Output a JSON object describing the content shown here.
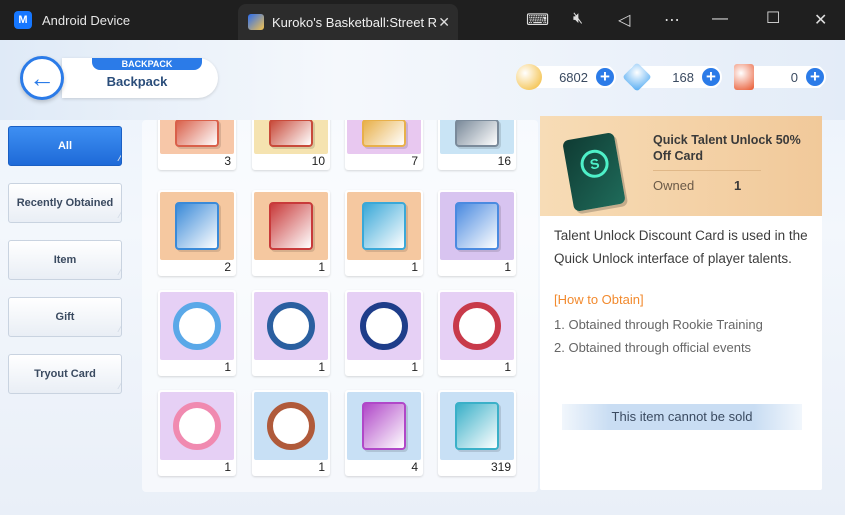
{
  "window": {
    "tab1_label": "Android Device",
    "tab2_label": "Kuroko's Basketball:Street Rivals",
    "close_tab": "✕",
    "controls": {
      "keyboard": "⌨",
      "mute": "🔇︎",
      "back": "◁",
      "more": "⋯",
      "minimize": "—",
      "maximize": "☐",
      "close": "✕"
    }
  },
  "header": {
    "back_arrow": "←",
    "badge": "BACKPACK",
    "title": "Backpack"
  },
  "currencies": [
    {
      "icon": "gold-coin-icon",
      "value": "6802",
      "color": "#f2b62a"
    },
    {
      "icon": "diamond-icon",
      "value": "168",
      "color": "#4fa9f2"
    },
    {
      "icon": "ticket-icon",
      "value": "0",
      "color": "#e8562e"
    }
  ],
  "plus": "+",
  "tabs": [
    "All",
    "Recently Obtained",
    "Item",
    "Gift",
    "Tryout Card"
  ],
  "active_tab": "All",
  "items": [
    {
      "count": "3",
      "bg": "#f7c7a8",
      "accent": "#d9604a",
      "kind": "shape"
    },
    {
      "count": "10",
      "bg": "#f5e3b0",
      "accent": "#c84a3a",
      "kind": "shape"
    },
    {
      "count": "7",
      "bg": "#e8c8f0",
      "accent": "#e8b04a",
      "kind": "shape"
    },
    {
      "count": "16",
      "bg": "#c9e4f5",
      "accent": "#7a8a9a",
      "kind": "shape"
    },
    {
      "count": "2",
      "bg": "#f5c8a0",
      "accent": "#3a8ad8",
      "kind": "shape"
    },
    {
      "count": "1",
      "bg": "#f5c8a0",
      "accent": "#c83a3a",
      "kind": "shape"
    },
    {
      "count": "1",
      "bg": "#f5c8a0",
      "accent": "#3aa8d8",
      "kind": "shape"
    },
    {
      "count": "1",
      "bg": "#d8c4f0",
      "accent": "#4a8ae0",
      "kind": "shape"
    },
    {
      "count": "1",
      "bg": "#e6d0f5",
      "accent": "#5aa8e8",
      "kind": "ring"
    },
    {
      "count": "1",
      "bg": "#e6d0f5",
      "accent": "#2a5fa0",
      "kind": "ring"
    },
    {
      "count": "1",
      "bg": "#e6d0f5",
      "accent": "#1e3d8a",
      "kind": "ring"
    },
    {
      "count": "1",
      "bg": "#e6d0f5",
      "accent": "#c83a4a",
      "kind": "ring"
    },
    {
      "count": "1",
      "bg": "#e6d0f5",
      "accent": "#f08ab0",
      "kind": "ring"
    },
    {
      "count": "1",
      "bg": "#c8e0f5",
      "accent": "#b05a3a",
      "kind": "ring"
    },
    {
      "count": "4",
      "bg": "#c8e0f5",
      "accent": "#b048c8",
      "kind": "shape"
    },
    {
      "count": "319",
      "bg": "#c8e0f5",
      "accent": "#3ab0c8",
      "kind": "shape"
    }
  ],
  "detail": {
    "name": "Quick Talent Unlock 50% Off Card",
    "owned_label": "Owned",
    "owned_value": "1",
    "description": "Talent Unlock Discount Card is used in the Quick Unlock interface of player talents.",
    "how_to_obtain": "[How to Obtain]",
    "steps": [
      "1. Obtained through Rookie Training",
      "2. Obtained through official events"
    ],
    "cannot_sell": "This item cannot be sold"
  }
}
